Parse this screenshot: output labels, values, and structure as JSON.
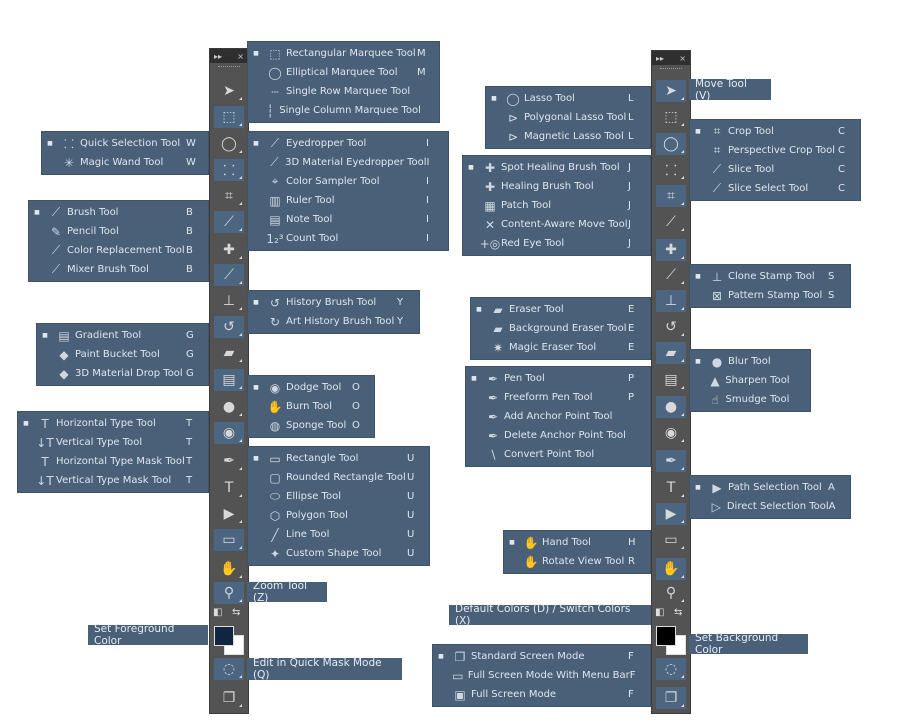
{
  "toolbar": {
    "collapse_icon": "▸▸",
    "close_icon": "×",
    "tools": [
      {
        "name": "move",
        "icon": "➤"
      },
      {
        "name": "marquee",
        "icon": "⬚"
      },
      {
        "name": "lasso",
        "icon": "◯"
      },
      {
        "name": "quick-selection",
        "icon": "⸬"
      },
      {
        "name": "crop",
        "icon": "⌗"
      },
      {
        "name": "eyedropper",
        "icon": "⟋"
      },
      {
        "name": "healing",
        "icon": "✚"
      },
      {
        "name": "brush",
        "icon": "⟋"
      },
      {
        "name": "stamp",
        "icon": "⊥"
      },
      {
        "name": "history-brush",
        "icon": "↺"
      },
      {
        "name": "eraser",
        "icon": "▰"
      },
      {
        "name": "gradient",
        "icon": "▤"
      },
      {
        "name": "blur",
        "icon": "●"
      },
      {
        "name": "dodge",
        "icon": "◉"
      },
      {
        "name": "pen",
        "icon": "✒"
      },
      {
        "name": "type",
        "icon": "T"
      },
      {
        "name": "path-selection",
        "icon": "▶"
      },
      {
        "name": "rectangle",
        "icon": "▭"
      },
      {
        "name": "hand",
        "icon": "✋"
      },
      {
        "name": "zoom",
        "icon": "⚲"
      }
    ],
    "default_colors_icon": "◧",
    "switch_colors_icon": "⇆",
    "quick_mask_icon": "◌",
    "screen_mode_icon": "❐",
    "foreground_color": "#0f2540",
    "background_color": "#ffffff"
  },
  "tooltips": {
    "zoom": "Zoom Tool (Z)",
    "set_foreground": "Set Foreground Color",
    "quick_mask": "Edit in Quick Mask Mode (Q)",
    "move": "Move Tool (V)",
    "default_colors": "Default Colors (D) / Switch Colors (X)",
    "set_background": "Set Background Color"
  },
  "panels": [
    {
      "id": "marquee",
      "items": [
        [
          "■",
          "⬚",
          "Rectangular Marquee Tool",
          "M"
        ],
        [
          "",
          "◯",
          "Elliptical Marquee Tool",
          "M"
        ],
        [
          "",
          "┄",
          "Single Row Marquee Tool",
          ""
        ],
        [
          "",
          "┆",
          "Single Column Marquee Tool",
          ""
        ]
      ]
    },
    {
      "id": "quick-selection",
      "items": [
        [
          "■",
          "⸬",
          "Quick Selection Tool",
          "W"
        ],
        [
          "",
          "✳",
          "Magic Wand Tool",
          "W"
        ]
      ]
    },
    {
      "id": "eyedropper",
      "items": [
        [
          "■",
          "⟋",
          "Eyedropper Tool",
          "I"
        ],
        [
          "",
          "⟋",
          "3D Material Eyedropper Tool",
          "I"
        ],
        [
          "",
          "⌖",
          "Color Sampler Tool",
          "I"
        ],
        [
          "",
          "▥",
          "Ruler Tool",
          "I"
        ],
        [
          "",
          "▤",
          "Note Tool",
          "I"
        ],
        [
          "",
          "1₂³",
          "Count Tool",
          "I"
        ]
      ]
    },
    {
      "id": "brush",
      "items": [
        [
          "■",
          "⟋",
          "Brush Tool",
          "B"
        ],
        [
          "",
          "✎",
          "Pencil Tool",
          "B"
        ],
        [
          "",
          "⟋",
          "Color Replacement Tool",
          "B"
        ],
        [
          "",
          "⟋",
          "Mixer Brush Tool",
          "B"
        ]
      ]
    },
    {
      "id": "history",
      "items": [
        [
          "■",
          "↺",
          "History Brush Tool",
          "Y"
        ],
        [
          "",
          "↻",
          "Art History Brush Tool",
          "Y"
        ]
      ]
    },
    {
      "id": "gradient",
      "items": [
        [
          "■",
          "▤",
          "Gradient Tool",
          "G"
        ],
        [
          "",
          "◆",
          "Paint Bucket Tool",
          "G"
        ],
        [
          "",
          "◆",
          "3D Material Drop Tool",
          "G"
        ]
      ]
    },
    {
      "id": "dodge",
      "items": [
        [
          "■",
          "◉",
          "Dodge Tool",
          "O"
        ],
        [
          "",
          "✋",
          "Burn Tool",
          "O"
        ],
        [
          "",
          "◍",
          "Sponge Tool",
          "O"
        ]
      ]
    },
    {
      "id": "type",
      "items": [
        [
          "■",
          "T",
          "Horizontal Type Tool",
          "T"
        ],
        [
          "",
          "↓T",
          "Vertical Type Tool",
          "T"
        ],
        [
          "",
          "T",
          "Horizontal Type Mask Tool",
          "T"
        ],
        [
          "",
          "↓T",
          "Vertical Type Mask Tool",
          "T"
        ]
      ]
    },
    {
      "id": "shape",
      "items": [
        [
          "■",
          "▭",
          "Rectangle Tool",
          "U"
        ],
        [
          "",
          "▢",
          "Rounded Rectangle Tool",
          "U"
        ],
        [
          "",
          "⬭",
          "Ellipse Tool",
          "U"
        ],
        [
          "",
          "⬡",
          "Polygon Tool",
          "U"
        ],
        [
          "",
          "╱",
          "Line Tool",
          "U"
        ],
        [
          "",
          "✦",
          "Custom Shape Tool",
          "U"
        ]
      ]
    },
    {
      "id": "lasso",
      "items": [
        [
          "■",
          "◯",
          "Lasso Tool",
          "L"
        ],
        [
          "",
          "⊳",
          "Polygonal Lasso Tool",
          "L"
        ],
        [
          "",
          "⊳",
          "Magnetic Lasso Tool",
          "L"
        ]
      ]
    },
    {
      "id": "crop",
      "items": [
        [
          "■",
          "⌗",
          "Crop Tool",
          "C"
        ],
        [
          "",
          "⌗",
          "Perspective Crop Tool",
          "C"
        ],
        [
          "",
          "⟋",
          "Slice Tool",
          "C"
        ],
        [
          "",
          "⟋",
          "Slice Select Tool",
          "C"
        ]
      ]
    },
    {
      "id": "healing",
      "items": [
        [
          "■",
          "✚",
          "Spot Healing Brush Tool",
          "J"
        ],
        [
          "",
          "✚",
          "Healing Brush Tool",
          "J"
        ],
        [
          "",
          "▦",
          "Patch Tool",
          "J"
        ],
        [
          "",
          "✕",
          "Content-Aware Move Tool",
          "J"
        ],
        [
          "",
          "+◎",
          "Red Eye Tool",
          "J"
        ]
      ]
    },
    {
      "id": "stamp",
      "items": [
        [
          "■",
          "⊥",
          "Clone Stamp Tool",
          "S"
        ],
        [
          "",
          "⊠",
          "Pattern Stamp Tool",
          "S"
        ]
      ]
    },
    {
      "id": "eraser",
      "items": [
        [
          "■",
          "▰",
          "Eraser Tool",
          "E"
        ],
        [
          "",
          "▰",
          "Background Eraser Tool",
          "E"
        ],
        [
          "",
          "✷",
          "Magic Eraser Tool",
          "E"
        ]
      ]
    },
    {
      "id": "blur",
      "items": [
        [
          "■",
          "●",
          "Blur Tool",
          ""
        ],
        [
          "",
          "▲",
          "Sharpen Tool",
          ""
        ],
        [
          "",
          "☝",
          "Smudge Tool",
          ""
        ]
      ]
    },
    {
      "id": "pen",
      "items": [
        [
          "■",
          "✒",
          "Pen Tool",
          "P"
        ],
        [
          "",
          "✒",
          "Freeform Pen Tool",
          "P"
        ],
        [
          "",
          "✒",
          "Add Anchor Point Tool",
          ""
        ],
        [
          "",
          "✒",
          "Delete Anchor Point Tool",
          ""
        ],
        [
          "",
          "∖",
          "Convert Point Tool",
          ""
        ]
      ]
    },
    {
      "id": "path-selection",
      "items": [
        [
          "■",
          "▶",
          "Path Selection Tool",
          "A"
        ],
        [
          "",
          "▷",
          "Direct Selection Tool",
          "A"
        ]
      ]
    },
    {
      "id": "hand",
      "items": [
        [
          "■",
          "✋",
          "Hand Tool",
          "H"
        ],
        [
          "",
          "✋",
          "Rotate View Tool",
          "R"
        ]
      ]
    },
    {
      "id": "screen-mode",
      "items": [
        [
          "■",
          "❐",
          "Standard Screen Mode",
          "F"
        ],
        [
          "",
          "▭",
          "Full Screen Mode With Menu Bar",
          "F"
        ],
        [
          "",
          "▣",
          "Full Screen Mode",
          "F"
        ]
      ]
    }
  ]
}
